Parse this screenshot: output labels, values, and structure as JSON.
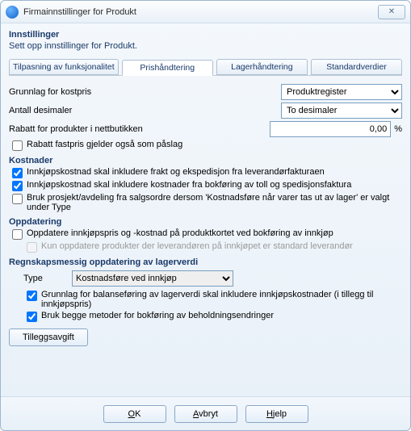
{
  "window": {
    "title": "Firmainnstillinger for Produkt"
  },
  "header": {
    "title": "Innstillinger",
    "subtitle": "Sett opp innstillinger for Produkt."
  },
  "tabs": {
    "t0": "Tilpasning av funksjonalitet",
    "t1": "Prishåndtering",
    "t2": "Lagerhåndtering",
    "t3": "Standardverdier"
  },
  "fields": {
    "costbase_label": "Grunnlag for kostpris",
    "costbase_value": "Produktregister",
    "decimals_label": "Antall desimaler",
    "decimals_value": "To desimaler",
    "webshop_discount_label": "Rabatt for produkter i nettbutikken",
    "webshop_discount_value": "0,00",
    "webshop_discount_unit": "%"
  },
  "chk": {
    "fastpris": "Rabatt fastpris gjelder også som påslag"
  },
  "sections": {
    "kostnader": "Kostnader",
    "oppdatering": "Oppdatering",
    "regnskap": "Regnskapsmessig oppdatering av lagerverdi"
  },
  "kostnader": {
    "k1": "Innkjøpskostnad skal inkludere frakt og ekspedisjon fra leverandørfakturaen",
    "k2": "Innkjøpskostnad skal inkludere kostnader fra bokføring av toll og spedisjonsfaktura",
    "k3": "Bruk prosjekt/avdeling fra salgsordre dersom 'Kostnadsføre når varer tas ut av lager' er valgt under Type"
  },
  "oppdatering": {
    "o1": "Oppdatere innkjøpspris og -kostnad på produktkortet ved bokføring av innkjøp",
    "o2": "Kun oppdatere produkter der leverandøren på innkjøpet er standard leverandør"
  },
  "regnskap": {
    "type_label": "Type",
    "type_value": "Kostnadsføre ved innkjøp",
    "r1": "Grunnlag for balanseføring av lagerverdi skal inkludere innkjøpskostnader (i tillegg til innkjøpspris)",
    "r2": "Bruk begge metoder for bokføring av beholdningsendringer"
  },
  "buttons": {
    "tillegg": "Tilleggsavgift",
    "ok": "OK",
    "cancel": "Avbryt",
    "help": "Hjelp"
  }
}
